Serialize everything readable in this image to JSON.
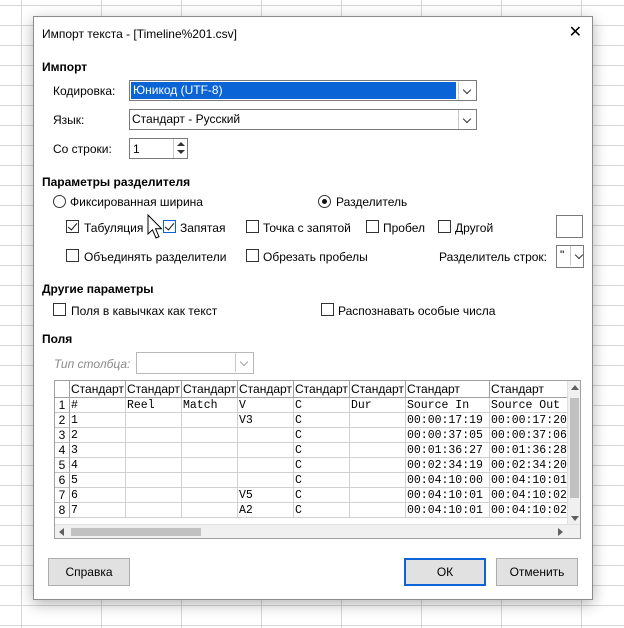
{
  "window": {
    "title": "Импорт текста - [Timeline%201.csv]",
    "close_glyph": "✕"
  },
  "import": {
    "section": "Импорт",
    "encoding_label": "Кодировка:",
    "encoding_value": "Юникод (UTF-8)",
    "language_label": "Язык:",
    "language_value": "Стандарт - Русский",
    "from_row_label": "Со строки:",
    "from_row_value": "1"
  },
  "separator": {
    "section": "Параметры разделителя",
    "fixed_width_label": "Фиксированная ширина",
    "separated_label": "Разделитель",
    "tab_label": "Табуляция",
    "comma_label": "Запятая",
    "semicolon_label": "Точка с запятой",
    "space_label": "Пробел",
    "other_label": "Другой",
    "merge_label": "Объединять разделители",
    "trim_label": "Обрезать пробелы",
    "string_delim_label": "Разделитель строк:",
    "string_delim_value": "\""
  },
  "other": {
    "section": "Другие параметры",
    "quoted_as_text_label": "Поля в кавычках как текст",
    "detect_special_label": "Распознавать особые числа"
  },
  "fields": {
    "section": "Поля",
    "column_type_label": "Тип столбца:",
    "headers": [
      "Стандарт",
      "Стандарт",
      "Стандарт",
      "Стандарт",
      "Стандарт",
      "Стандарт",
      "Стандарт",
      "Стандарт"
    ],
    "row_numbers": [
      "1",
      "2",
      "3",
      "4",
      "5",
      "6",
      "7",
      "8"
    ],
    "rows": [
      [
        "#",
        "Reel",
        "Match",
        "V",
        "C",
        "Dur",
        "Source In",
        "Source Out"
      ],
      [
        "1",
        "",
        "",
        "V3",
        "C",
        "",
        "00:00:17:19",
        "00:00:17:20"
      ],
      [
        "2",
        "",
        "",
        "",
        "C",
        "",
        "00:00:37:05",
        "00:00:37:06"
      ],
      [
        "3",
        "",
        "",
        "",
        "C",
        "",
        "00:01:36:27",
        "00:01:36:28"
      ],
      [
        "4",
        "",
        "",
        "",
        "C",
        "",
        "00:02:34:19",
        "00:02:34:20"
      ],
      [
        "5",
        "",
        "",
        "",
        "C",
        "",
        "00:04:10:00",
        "00:04:10:01"
      ],
      [
        "6",
        "",
        "",
        "V5",
        "C",
        "",
        "00:04:10:01",
        "00:04:10:02"
      ],
      [
        "7",
        "",
        "",
        "A2",
        "C",
        "",
        "00:04:10:01",
        "00:04:10:02"
      ]
    ]
  },
  "buttons": {
    "help": "Справка",
    "ok": "ОК",
    "cancel": "Отменить"
  },
  "colors": {
    "selection": "#0a64d6",
    "dialog_bg": "#ffffff"
  }
}
